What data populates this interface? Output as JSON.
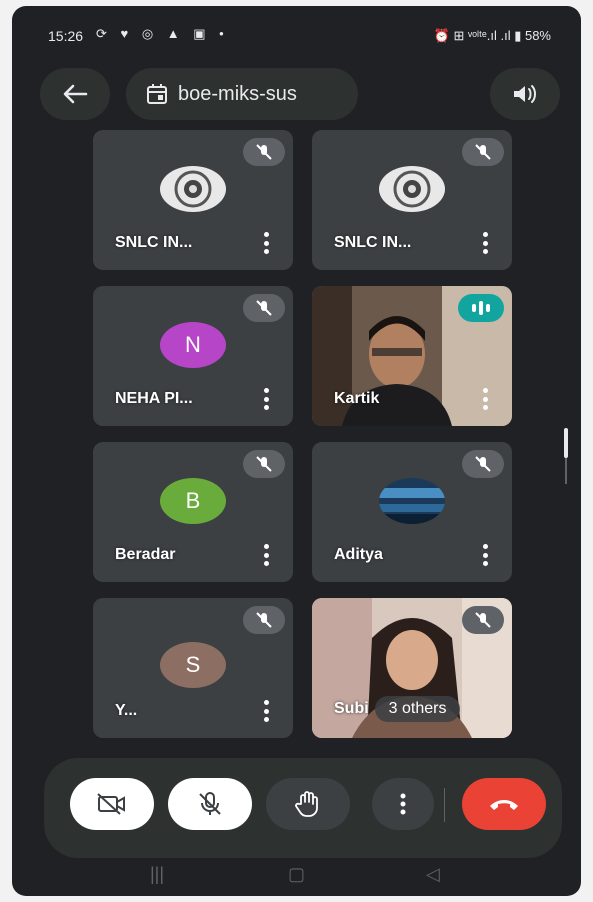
{
  "status_bar": {
    "time": "15:26",
    "left_icons": "⟳ ♥ ◎ ▲ ▣ •",
    "right_icons": "⏰ ⊞ ᵛᵒˡᵗᵉ.ıl .ıl ▮ 58%"
  },
  "header": {
    "back_icon": "arrow-left-icon",
    "meeting_code": "boe-miks-sus",
    "calendar_icon": "calendar-icon",
    "audio_icon": "speaker-icon"
  },
  "participants": [
    {
      "name": "SNLC IN...",
      "type": "logo",
      "muted": true
    },
    {
      "name": "SNLC IN...",
      "type": "logo",
      "muted": true
    },
    {
      "name": "NEHA PI...",
      "type": "initial",
      "initial": "N",
      "color": "#b646c7",
      "muted": true
    },
    {
      "name": "Kartik",
      "type": "video",
      "speaking": true
    },
    {
      "name": "Beradar",
      "type": "initial",
      "initial": "B",
      "color": "#6aac3c",
      "muted": true
    },
    {
      "name": "Aditya",
      "type": "photo",
      "muted": true
    },
    {
      "name": "Y...",
      "type": "initial",
      "initial": "S",
      "color": "#8d6e63",
      "muted": true
    },
    {
      "name": "Subi",
      "type": "video",
      "others": "3 others",
      "muted": true
    }
  ],
  "controls": {
    "camera": "camera-off-icon",
    "mic": "mic-off-icon",
    "raise_hand": "hand-icon",
    "more": "more-vert-icon",
    "end_call": "end-call-icon"
  },
  "colors": {
    "background": "#202124",
    "tile": "#3c4043",
    "speaking": "#12a5a0",
    "end_call": "#ea4335"
  }
}
